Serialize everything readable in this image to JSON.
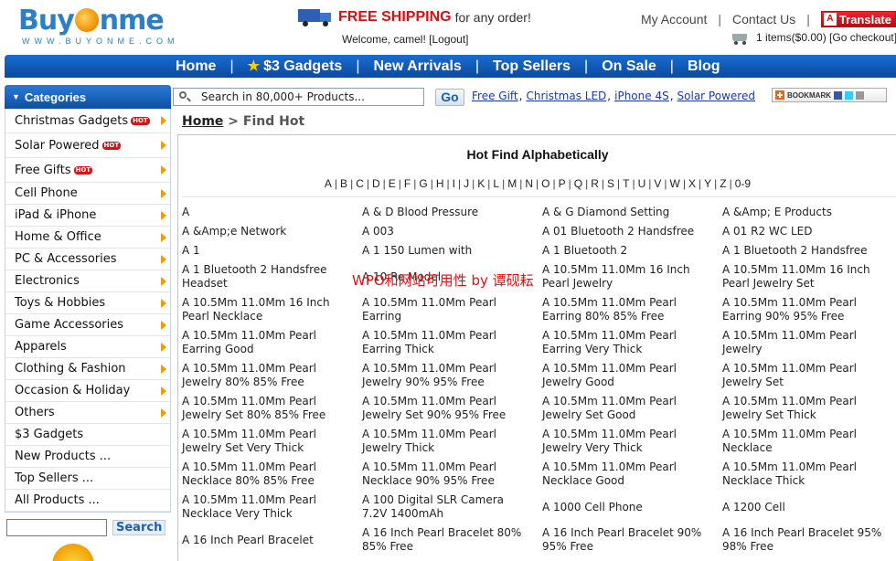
{
  "brand": {
    "name_left": "Buy",
    "name_right": "nme",
    "tagline": "WWW.BUYONME.COM"
  },
  "shipping": {
    "strong": "FREE SHIPPING",
    "rest": "for any order!"
  },
  "welcome": "Welcome, camel! [Logout]",
  "toplinks": {
    "account": "My Account",
    "contact": "Contact Us",
    "translate": "Translate"
  },
  "cart": {
    "summary": "1 items($0.00) [Go checkout]"
  },
  "nav": [
    {
      "label": "Home"
    },
    {
      "label": "$3 Gadgets"
    },
    {
      "label": "New Arrivals"
    },
    {
      "label": "Top Sellers"
    },
    {
      "label": "On Sale"
    },
    {
      "label": "Blog"
    }
  ],
  "sidebar": {
    "header": "Categories",
    "hot_label": "HOT",
    "items": [
      {
        "label": "Christmas Gadgets",
        "hot": true
      },
      {
        "label": "Solar Powered",
        "hot": true
      },
      {
        "label": "Free Gifts",
        "hot": true
      },
      {
        "label": "Cell Phone"
      },
      {
        "label": "iPad & iPhone"
      },
      {
        "label": "Home & Office"
      },
      {
        "label": "PC & Accessories"
      },
      {
        "label": "Electronics"
      },
      {
        "label": "Toys & Hobbies"
      },
      {
        "label": "Game Accessories"
      },
      {
        "label": "Apparels"
      },
      {
        "label": "Clothing & Fashion"
      },
      {
        "label": "Occasion & Holiday"
      },
      {
        "label": "Others"
      },
      {
        "label": "$3 Gadgets"
      },
      {
        "label": "New Products ..."
      },
      {
        "label": "Top Sellers ..."
      },
      {
        "label": "All Products ..."
      }
    ],
    "search_button": "Search"
  },
  "search": {
    "value": "Search in 80,000+ Products...",
    "button": "Go"
  },
  "quicklinks": [
    "Free Gift",
    "Christmas LED",
    "iPhone 4S",
    "Solar Powered"
  ],
  "bookmark": "BOOKMARK",
  "breadcrumb": {
    "home": "Home",
    "current": "Find Hot"
  },
  "heading": "Hot Find Alphabetically",
  "alphabet": [
    "A",
    "B",
    "C",
    "D",
    "E",
    "F",
    "G",
    "H",
    "I",
    "J",
    "K",
    "L",
    "M",
    "N",
    "O",
    "P",
    "Q",
    "R",
    "S",
    "T",
    "U",
    "V",
    "W",
    "X",
    "Y",
    "Z",
    "0-9"
  ],
  "products": [
    [
      "A",
      "A & D Blood Pressure",
      "A & G Diamond Setting",
      "A &Amp; E Products"
    ],
    [
      "A &Amp;e Network",
      "A 003",
      "A 01 Bluetooth 2 Handsfree",
      "A 01 R2 WC LED"
    ],
    [
      "A 1",
      "A 1 150 Lumen with",
      "A 1 Bluetooth 2",
      "A 1 Bluetooth 2 Handsfree"
    ],
    [
      "A 1 Bluetooth 2 Handsfree Headset",
      "A 10 Re Model",
      "A 10.5Mm 11.0Mm 16 Inch Pearl Jewelry",
      "A 10.5Mm 11.0Mm 16 Inch Pearl Jewelry Set"
    ],
    [
      "A 10.5Mm 11.0Mm 16 Inch Pearl Necklace",
      "A 10.5Mm 11.0Mm Pearl Earring",
      "A 10.5Mm 11.0Mm Pearl Earring 80% 85% Free",
      "A 10.5Mm 11.0Mm Pearl Earring 90% 95% Free"
    ],
    [
      "A 10.5Mm 11.0Mm Pearl Earring Good",
      "A 10.5Mm 11.0Mm Pearl Earring Thick",
      "A 10.5Mm 11.0Mm Pearl Earring Very Thick",
      "A 10.5Mm 11.0Mm Pearl Jewelry"
    ],
    [
      "A 10.5Mm 11.0Mm Pearl Jewelry 80% 85% Free",
      "A 10.5Mm 11.0Mm Pearl Jewelry 90% 95% Free",
      "A 10.5Mm 11.0Mm Pearl Jewelry Good",
      "A 10.5Mm 11.0Mm Pearl Jewelry Set"
    ],
    [
      "A 10.5Mm 11.0Mm Pearl Jewelry Set 80% 85% Free",
      "A 10.5Mm 11.0Mm Pearl Jewelry Set 90% 95% Free",
      "A 10.5Mm 11.0Mm Pearl Jewelry Set Good",
      "A 10.5Mm 11.0Mm Pearl Jewelry Set Thick"
    ],
    [
      "A 10.5Mm 11.0Mm Pearl Jewelry Set Very Thick",
      "A 10.5Mm 11.0Mm Pearl Jewelry Thick",
      "A 10.5Mm 11.0Mm Pearl Jewelry Very Thick",
      "A 10.5Mm 11.0Mm Pearl Necklace"
    ],
    [
      "A 10.5Mm 11.0Mm Pearl Necklace 80% 85% Free",
      "A 10.5Mm 11.0Mm Pearl Necklace 90% 95% Free",
      "A 10.5Mm 11.0Mm Pearl Necklace Good",
      "A 10.5Mm 11.0Mm Pearl Necklace Thick"
    ],
    [
      "A 10.5Mm 11.0Mm Pearl Necklace Very Thick",
      "A 100 Digital SLR Camera 7.2V 1400mAh",
      "A 1000 Cell Phone",
      "A 1200 Cell"
    ],
    [
      "A 16 Inch Pearl Bracelet",
      "A 16 Inch Pearl Bracelet 80% 85% Free",
      "A 16 Inch Pearl Bracelet 90% 95% Free",
      "A 16 Inch Pearl Bracelet 95% 98% Free"
    ]
  ],
  "watermark": "WPO和网站可用性 by 谭砚耘",
  "colors": {
    "brand_blue": "#1a6cd0",
    "hot_red": "#d01616",
    "arrow_orange": "#f29a00",
    "link_blue": "#1a3aa8"
  }
}
